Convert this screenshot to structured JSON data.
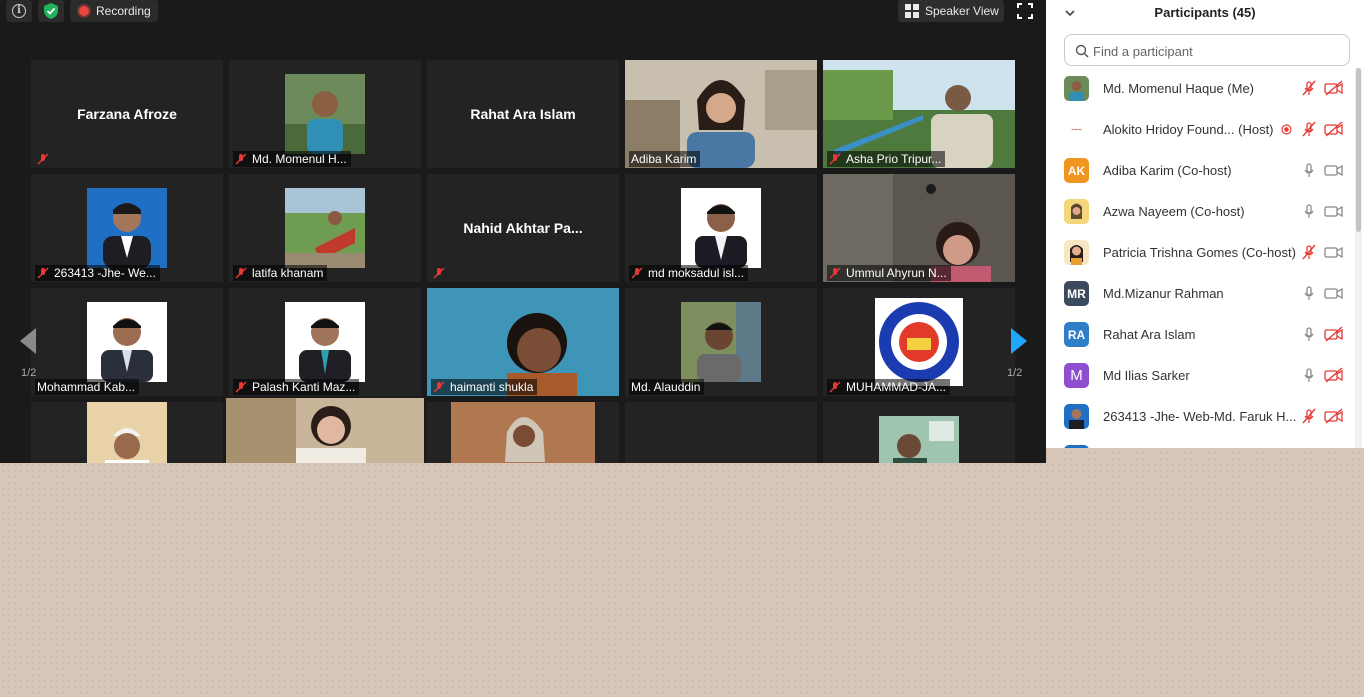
{
  "meeting": {
    "recording_label": "Recording",
    "view_label": "Speaker View",
    "page_left": "1/2",
    "page_right": "1/2",
    "tiles": [
      {
        "name": "Farzana Afroze",
        "mode": "name"
      },
      {
        "name": "Md. Momenul H...",
        "mode": "photo"
      },
      {
        "name": "Rahat Ara Islam",
        "mode": "name"
      },
      {
        "name": "Adiba Karim",
        "mode": "video",
        "muted": false
      },
      {
        "name": "Asha Prio Tripur...",
        "mode": "video"
      },
      {
        "name": "263413 -Jhe- We...",
        "mode": "photo"
      },
      {
        "name": "latifa khanam",
        "mode": "photo"
      },
      {
        "name": "Nahid Akhtar Pa...",
        "mode": "name"
      },
      {
        "name": "md moksadul isl...",
        "mode": "photo"
      },
      {
        "name": "Ummul Ahyrun N...",
        "mode": "video"
      },
      {
        "name": "Mohammad Kab...",
        "mode": "photo",
        "muted": false
      },
      {
        "name": "Palash Kanti Maz...",
        "mode": "photo"
      },
      {
        "name": "haimanti shukla",
        "mode": "video"
      },
      {
        "name": "Md. Alauddin",
        "mode": "photo",
        "muted": false
      },
      {
        "name": "MUHAMMAD-JA...",
        "mode": "photo"
      }
    ]
  },
  "participants": {
    "title": "Participants (45)",
    "search_placeholder": "Find a participant",
    "list": [
      {
        "name": "Md. Momenul Haque (Me)",
        "avatar": "photo",
        "mic": "muted",
        "cam": "off"
      },
      {
        "name": "Alokito Hridoy Found... (Host)",
        "avatar": "logo",
        "recording": true,
        "mic": "muted",
        "cam": "off"
      },
      {
        "name": "Adiba Karim (Co-host)",
        "avatar": "AK",
        "avatar_color": "#f0951f",
        "mic": "on",
        "cam": "on"
      },
      {
        "name": "Azwa Nayeem (Co-host)",
        "avatar": "photo",
        "mic": "on",
        "cam": "on"
      },
      {
        "name": "Patricia Trishna Gomes (Co-host)",
        "avatar": "photo",
        "mic": "muted",
        "cam": "on"
      },
      {
        "name": "Md.Mizanur Rahman",
        "avatar": "MR",
        "avatar_color": "#3b4a5c",
        "mic": "on",
        "cam": "on"
      },
      {
        "name": "Rahat Ara Islam",
        "avatar": "RA",
        "avatar_color": "#2f7fc8",
        "mic": "on",
        "cam": "off"
      },
      {
        "name": "Md Ilias Sarker",
        "avatar": "M",
        "avatar_color": "#8e4ecf",
        "mic": "on",
        "cam": "off"
      },
      {
        "name": "263413 -Jhe- Web-Md. Faruk H...",
        "avatar": "photo",
        "mic": "muted",
        "cam": "off"
      }
    ]
  },
  "colors": {
    "meeting_bg": "#1a1a1a",
    "tile_bg": "#232323",
    "active_speaker": "#9bd43a",
    "muted_red": "#e53935",
    "nav_blue": "#1ea7fd",
    "desktop_bg": "#d8c6b8"
  }
}
